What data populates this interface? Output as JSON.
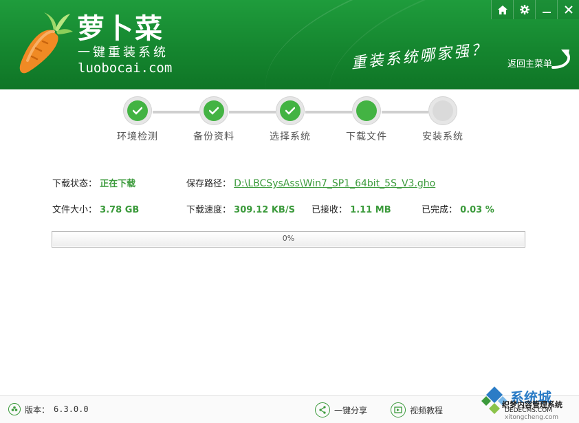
{
  "brand": {
    "title": "萝卜菜",
    "subtitle": "一键重装系统",
    "url": "luobocai.com",
    "slogan": "重装系统哪家强？"
  },
  "window_controls": {
    "home_icon": "home-icon",
    "settings_icon": "gear-icon",
    "minimize_icon": "minimize-icon",
    "close_icon": "close-icon"
  },
  "back_main": {
    "label": "返回主菜单",
    "icon": "back-arrow-icon"
  },
  "steps": [
    {
      "label": "环境检测",
      "status": "done"
    },
    {
      "label": "备份资料",
      "status": "done"
    },
    {
      "label": "选择系统",
      "status": "done"
    },
    {
      "label": "下载文件",
      "status": "active"
    },
    {
      "label": "安装系统",
      "status": "pending"
    }
  ],
  "download": {
    "status_label": "下载状态：",
    "status_value": "正在下载",
    "path_label": "保存路径：",
    "path_value": "D:\\LBCSysAss\\Win7_SP1_64bit_5S_V3.gho",
    "size_label": "文件大小：",
    "size_value": "3.78 GB",
    "speed_label": "下载速度：",
    "speed_value": "309.12 KB/S",
    "received_label": "已接收：",
    "received_value": "1.11 MB",
    "completed_label": "已完成：",
    "completed_value": "0.03 %"
  },
  "progress": {
    "percent": 0,
    "text": "0%"
  },
  "footer": {
    "version_label": "版本：",
    "version_value": "6.3.0.0",
    "share_label": "一键分享",
    "tutorial_label": "视频教程"
  },
  "watermark": {
    "text1": "系统城",
    "text2": "织梦内容管理系统",
    "text3": "DEDECMS.COM",
    "text4": "xitongcheng.com"
  },
  "colors": {
    "header_green": "#15862f",
    "accent_green": "#43b343",
    "value_green": "#3b9a3b"
  }
}
